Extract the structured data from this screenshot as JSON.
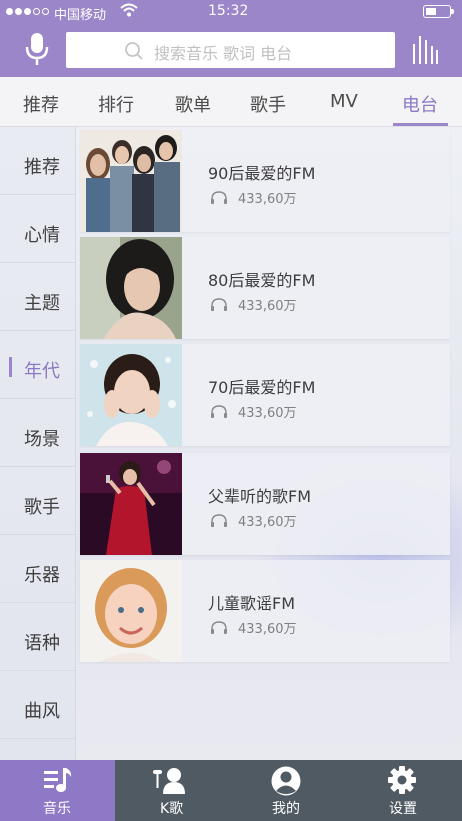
{
  "status_bar": {
    "carrier": "中国移动",
    "time": "15:32"
  },
  "search": {
    "placeholder": "搜索音乐   歌词   电台"
  },
  "tabs": [
    {
      "label": "推荐"
    },
    {
      "label": "排行"
    },
    {
      "label": "歌单"
    },
    {
      "label": "歌手"
    },
    {
      "label": "MV"
    },
    {
      "label": "电台"
    }
  ],
  "active_tab": "电台",
  "categories": [
    {
      "label": "推荐"
    },
    {
      "label": "心情"
    },
    {
      "label": "主题"
    },
    {
      "label": "年代"
    },
    {
      "label": "场景"
    },
    {
      "label": "歌手"
    },
    {
      "label": "乐器"
    },
    {
      "label": "语种"
    },
    {
      "label": "曲风"
    }
  ],
  "active_category": "年代",
  "stations": [
    {
      "title": "90后最爱的FM",
      "listeners": "433,60万"
    },
    {
      "title": "80后最爱的FM",
      "listeners": "433,60万"
    },
    {
      "title": "70后最爱的FM",
      "listeners": "433,60万"
    },
    {
      "title": "父辈听的歌FM",
      "listeners": "433,60万"
    },
    {
      "title": "儿童歌谣FM",
      "listeners": "433,60万"
    }
  ],
  "bottom_nav": [
    {
      "label": "音乐",
      "icon": "music-note-icon"
    },
    {
      "label": "K歌",
      "icon": "karaoke-mic-icon"
    },
    {
      "label": "我的",
      "icon": "profile-icon"
    },
    {
      "label": "设置",
      "icon": "gear-icon"
    }
  ],
  "active_nav": "音乐",
  "colors": {
    "accent": "#9a86c8",
    "bottom_bar": "#505a62",
    "active_nav": "#8d79c6"
  }
}
